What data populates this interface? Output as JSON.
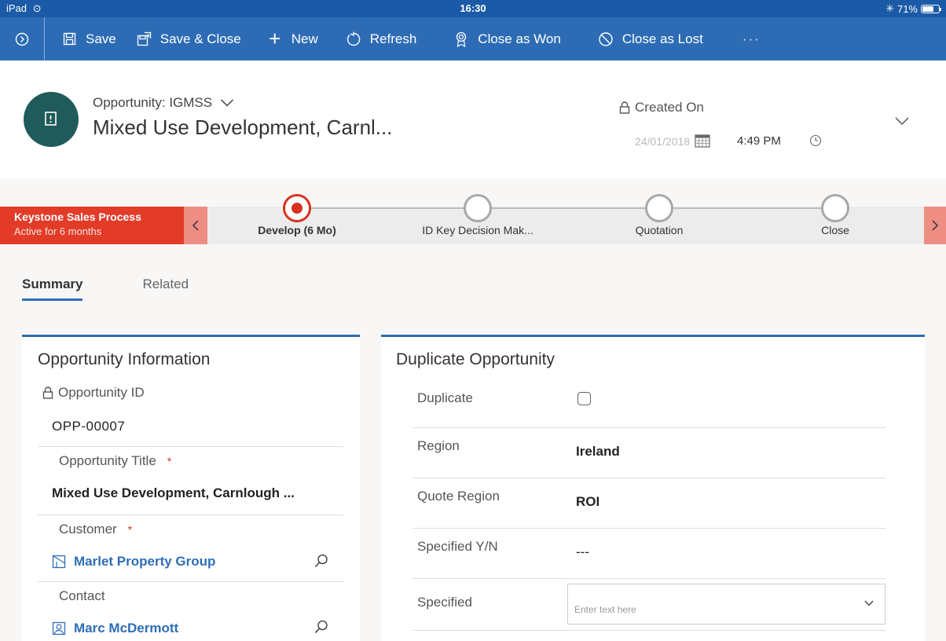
{
  "status_bar": {
    "device": "iPad",
    "time": "16:30",
    "battery": "71%",
    "battery_level": 0.71
  },
  "command_bar": {
    "save": "Save",
    "save_close": "Save & Close",
    "new": "New",
    "refresh": "Refresh",
    "close_won": "Close as Won",
    "close_lost": "Close as Lost",
    "more": "···"
  },
  "header": {
    "entity_form": "Opportunity: IGMSS",
    "title": "Mixed Use Development, Carnl...",
    "created_on_label": "Created On",
    "created_date": "24/01/2018",
    "created_time": "4:49 PM"
  },
  "process": {
    "name": "Keystone Sales Process",
    "active_for": "Active for 6 months",
    "stages": [
      {
        "label": "Develop  (6 Mo)",
        "active": true
      },
      {
        "label": "ID Key Decision Mak...",
        "active": false
      },
      {
        "label": "Quotation",
        "active": false
      },
      {
        "label": "Close",
        "active": false
      }
    ]
  },
  "tabs": [
    "Summary",
    "Related"
  ],
  "opportunity_info": {
    "title": "Opportunity Information",
    "id_label": "Opportunity ID",
    "id_value": "OPP-00007",
    "title_label": "Opportunity Title",
    "title_value": "Mixed Use Development, Carnlough ...",
    "customer_label": "Customer",
    "customer_value": "Marlet Property Group",
    "contact_label": "Contact",
    "contact_value": "Marc McDermott",
    "required_marker": "*"
  },
  "duplicate_opportunity": {
    "title": "Duplicate Opportunity",
    "duplicate_label": "Duplicate",
    "duplicate_checked": false,
    "region_label": "Region",
    "region_value": "Ireland",
    "quote_region_label": "Quote Region",
    "quote_region_value": "ROI",
    "specified_yn_label": "Specified Y/N",
    "specified_yn_value": "---",
    "specified_label": "Specified",
    "specified_placeholder": "Enter text here"
  },
  "colors": {
    "command_bar": "#2d6cb5",
    "status_bar": "#1a5aa6",
    "process_red": "#e23c29",
    "avatar": "#1f5b5a",
    "link": "#2f6db5"
  }
}
